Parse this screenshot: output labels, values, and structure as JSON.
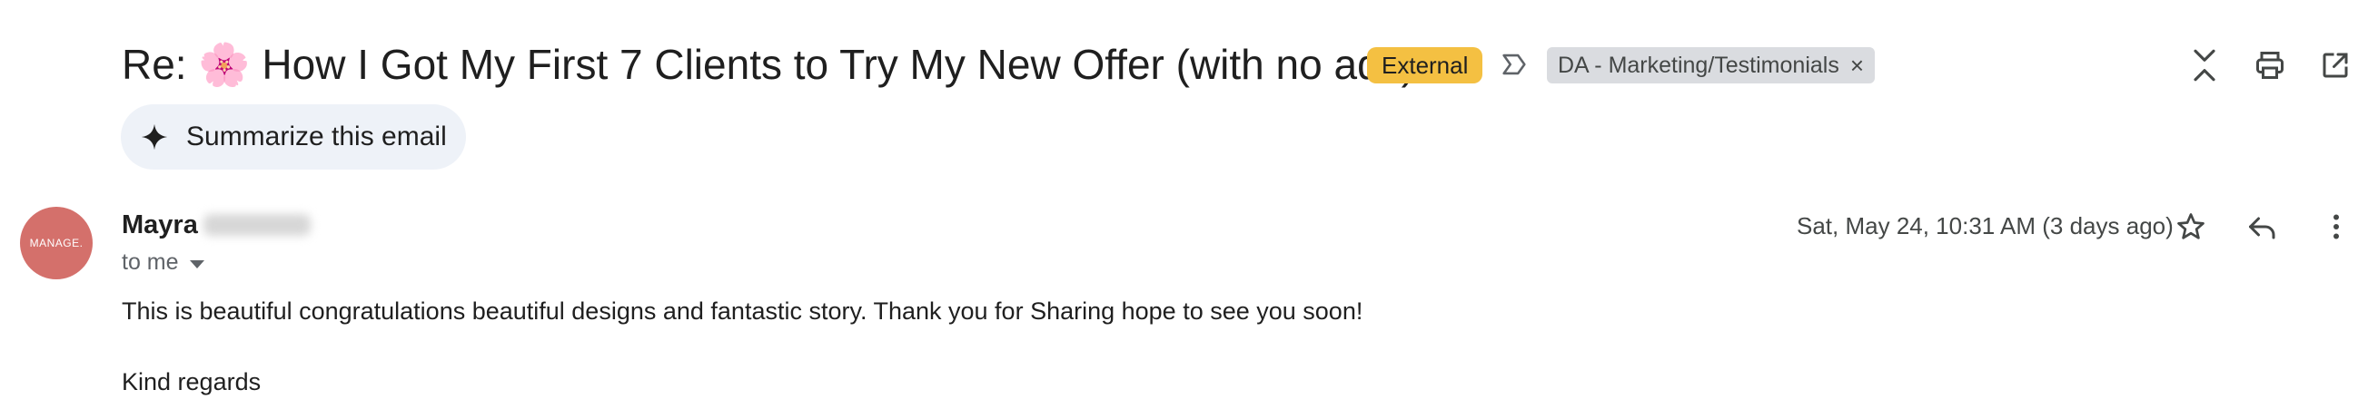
{
  "email": {
    "subject": "Re: 🌸 How I Got My First 7 Clients to Try My New Offer (with no ads)",
    "external_badge": "External",
    "label_chip": "DA - Marketing/Testimonials",
    "label_chip_remove": "×",
    "summarize_label": "Summarize this email",
    "sender": {
      "avatar_text": "MANAGE.",
      "first_name": "Mayra",
      "recipient_text": "to me"
    },
    "date_text": "Sat, May 24, 10:31 AM (3 days ago)",
    "body": "This is beautiful congratulations beautiful designs and fantastic story. Thank you for Sharing hope to see you soon!",
    "sign_off": "Kind regards"
  },
  "icons": {
    "top": [
      "collapse-all-icon",
      "print-icon",
      "open-in-new-window-icon"
    ],
    "row": [
      "star-icon",
      "reply-icon",
      "more-vert-icon"
    ],
    "label_arrow": "label-arrow-icon",
    "summarize": "sparkle-icon"
  },
  "colors": {
    "external_badge": "#f4c042",
    "label_chip": "#dadce0",
    "summarize_bg": "#eef2f8",
    "avatar_bg": "#d4706b"
  }
}
